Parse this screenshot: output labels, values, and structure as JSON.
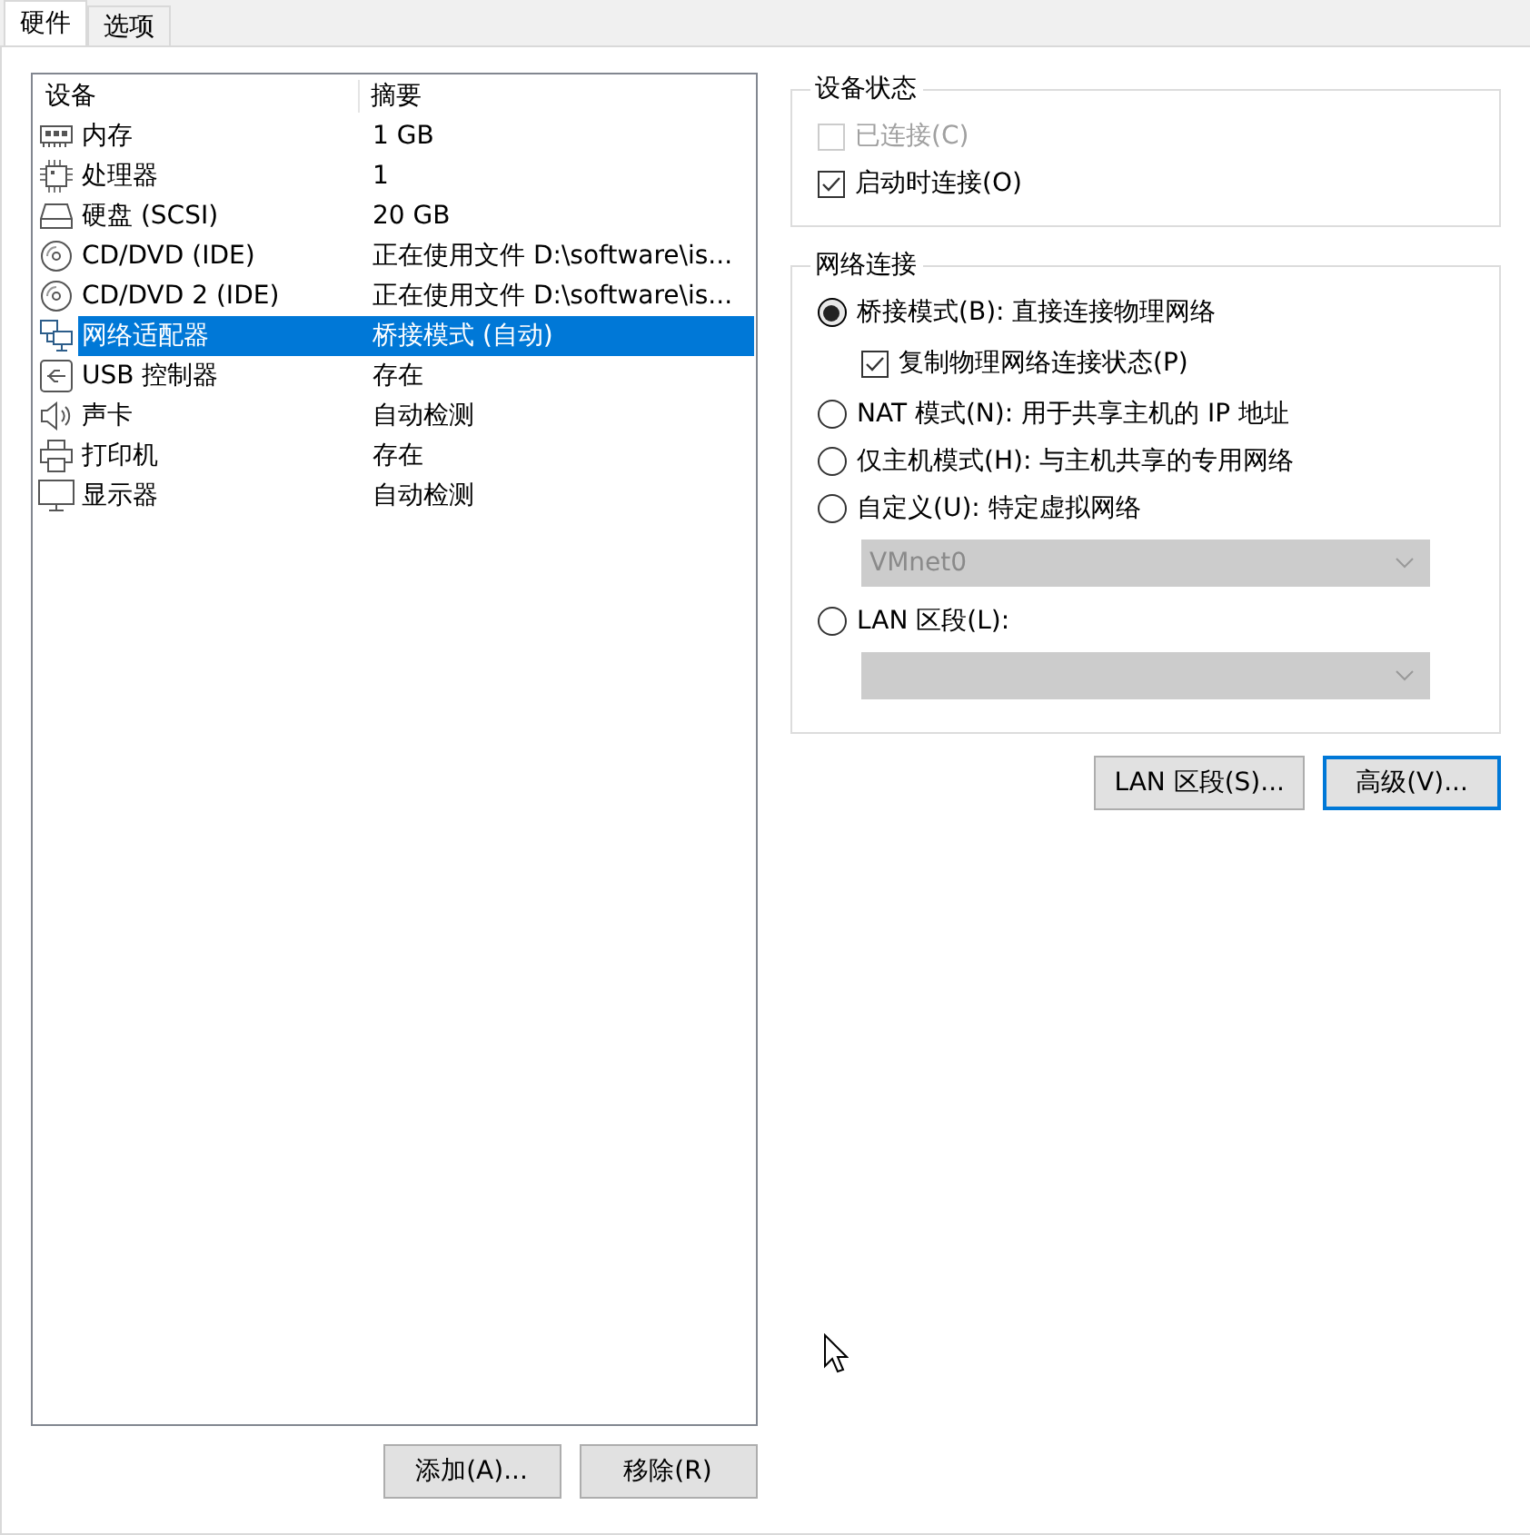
{
  "tabs": [
    {
      "label": "硬件",
      "selected": true
    },
    {
      "label": "选项",
      "selected": false
    }
  ],
  "device_list": {
    "columns": [
      "设备",
      "摘要"
    ],
    "rows": [
      {
        "kind": "memory",
        "device": "内存",
        "summary": "1 GB",
        "selected": false
      },
      {
        "kind": "cpu",
        "device": "处理器",
        "summary": "1",
        "selected": false
      },
      {
        "kind": "disk",
        "device": "硬盘 (SCSI)",
        "summary": "20 GB",
        "selected": false
      },
      {
        "kind": "cd",
        "device": "CD/DVD (IDE)",
        "summary": "正在使用文件 D:\\software\\is...",
        "selected": false
      },
      {
        "kind": "cd",
        "device": "CD/DVD 2 (IDE)",
        "summary": "正在使用文件 D:\\software\\is...",
        "selected": false
      },
      {
        "kind": "network",
        "device": "网络适配器",
        "summary": "桥接模式 (自动)",
        "selected": true
      },
      {
        "kind": "usb",
        "device": "USB 控制器",
        "summary": "存在",
        "selected": false
      },
      {
        "kind": "sound",
        "device": "声卡",
        "summary": "自动检测",
        "selected": false
      },
      {
        "kind": "printer",
        "device": "打印机",
        "summary": "存在",
        "selected": false
      },
      {
        "kind": "display",
        "device": "显示器",
        "summary": "自动检测",
        "selected": false
      }
    ]
  },
  "list_buttons": [
    "添加(A)...",
    "移除(R)"
  ],
  "device_status": {
    "title": "设备状态",
    "options": [
      {
        "label": "已连接(C)",
        "checked": false,
        "disabled": true
      },
      {
        "label": "启动时连接(O)",
        "checked": true,
        "disabled": false
      }
    ]
  },
  "network_connection": {
    "title": "网络连接",
    "options": [
      {
        "kind": "radio",
        "label": "桥接模式(B): 直接连接物理网络",
        "selected": true
      },
      {
        "kind": "checkbox",
        "label": "复制物理网络连接状态(P)",
        "checked": true
      },
      {
        "kind": "radio",
        "label": "NAT 模式(N): 用于共享主机的 IP 地址",
        "selected": false
      },
      {
        "kind": "radio",
        "label": "仅主机模式(H): 与主机共享的专用网络",
        "selected": false
      },
      {
        "kind": "radio",
        "label": "自定义(U): 特定虚拟网络",
        "selected": false
      },
      {
        "kind": "dropdown",
        "value": "VMnet0",
        "disabled": true
      },
      {
        "kind": "radio",
        "label": "LAN 区段(L):",
        "selected": false
      },
      {
        "kind": "dropdown",
        "disabled": true
      }
    ]
  },
  "buttons": [
    {
      "label": "LAN 区段(S)...",
      "focused": false
    },
    {
      "label": "高级(V)...",
      "focused": true
    }
  ]
}
